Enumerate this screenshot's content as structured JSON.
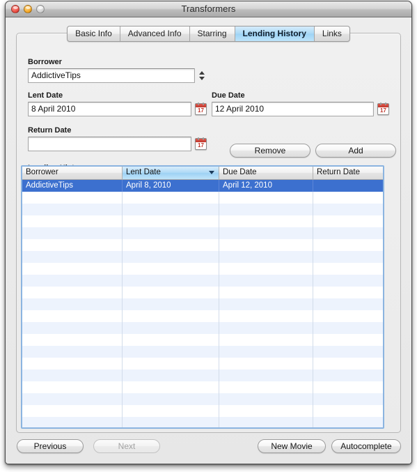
{
  "window": {
    "title": "Transformers",
    "traffic_lights": [
      "close-button",
      "minimize-button",
      "zoom-button"
    ]
  },
  "tabs": [
    {
      "label": "Basic Info",
      "active": false
    },
    {
      "label": "Advanced Info",
      "active": false
    },
    {
      "label": "Starring",
      "active": false
    },
    {
      "label": "Lending History",
      "active": true
    },
    {
      "label": "Links",
      "active": false
    }
  ],
  "form": {
    "borrower": {
      "label": "Borrower",
      "value": "AddictiveTips",
      "placeholder": ""
    },
    "lent_date": {
      "label": "Lent Date",
      "value": "8 April 2010",
      "placeholder": "",
      "calendar_icon_day": "17"
    },
    "due_date": {
      "label": "Due Date",
      "value": "12 April 2010",
      "placeholder": "",
      "calendar_icon_day": "17"
    },
    "return_date": {
      "label": "Return Date",
      "value": "",
      "placeholder": "",
      "calendar_icon_day": "17"
    },
    "remove_label": "Remove",
    "add_label": "Add"
  },
  "table": {
    "caption": "Lending History",
    "columns": [
      {
        "label": "Borrower",
        "sorted": false,
        "sort_dir": ""
      },
      {
        "label": "Lent Date",
        "sorted": true,
        "sort_dir": "desc"
      },
      {
        "label": "Due Date",
        "sorted": false,
        "sort_dir": ""
      },
      {
        "label": "Return Date",
        "sorted": false,
        "sort_dir": ""
      }
    ],
    "rows": [
      {
        "selected": true,
        "cells": [
          "AddictiveTips",
          "April 8, 2010",
          "April 12, 2010",
          ""
        ]
      }
    ],
    "empty_row_count": 21
  },
  "footer": {
    "previous_label": "Previous",
    "next_label": "Next",
    "next_disabled": true,
    "new_movie_label": "New Movie",
    "autocomplete_label": "Autocomplete"
  },
  "colors": {
    "selection_blue": "#3c70cf",
    "active_tab_blue": "#9ed3f5",
    "focus_ring": "#8bb4e0",
    "stripe": "#edf3fd"
  }
}
